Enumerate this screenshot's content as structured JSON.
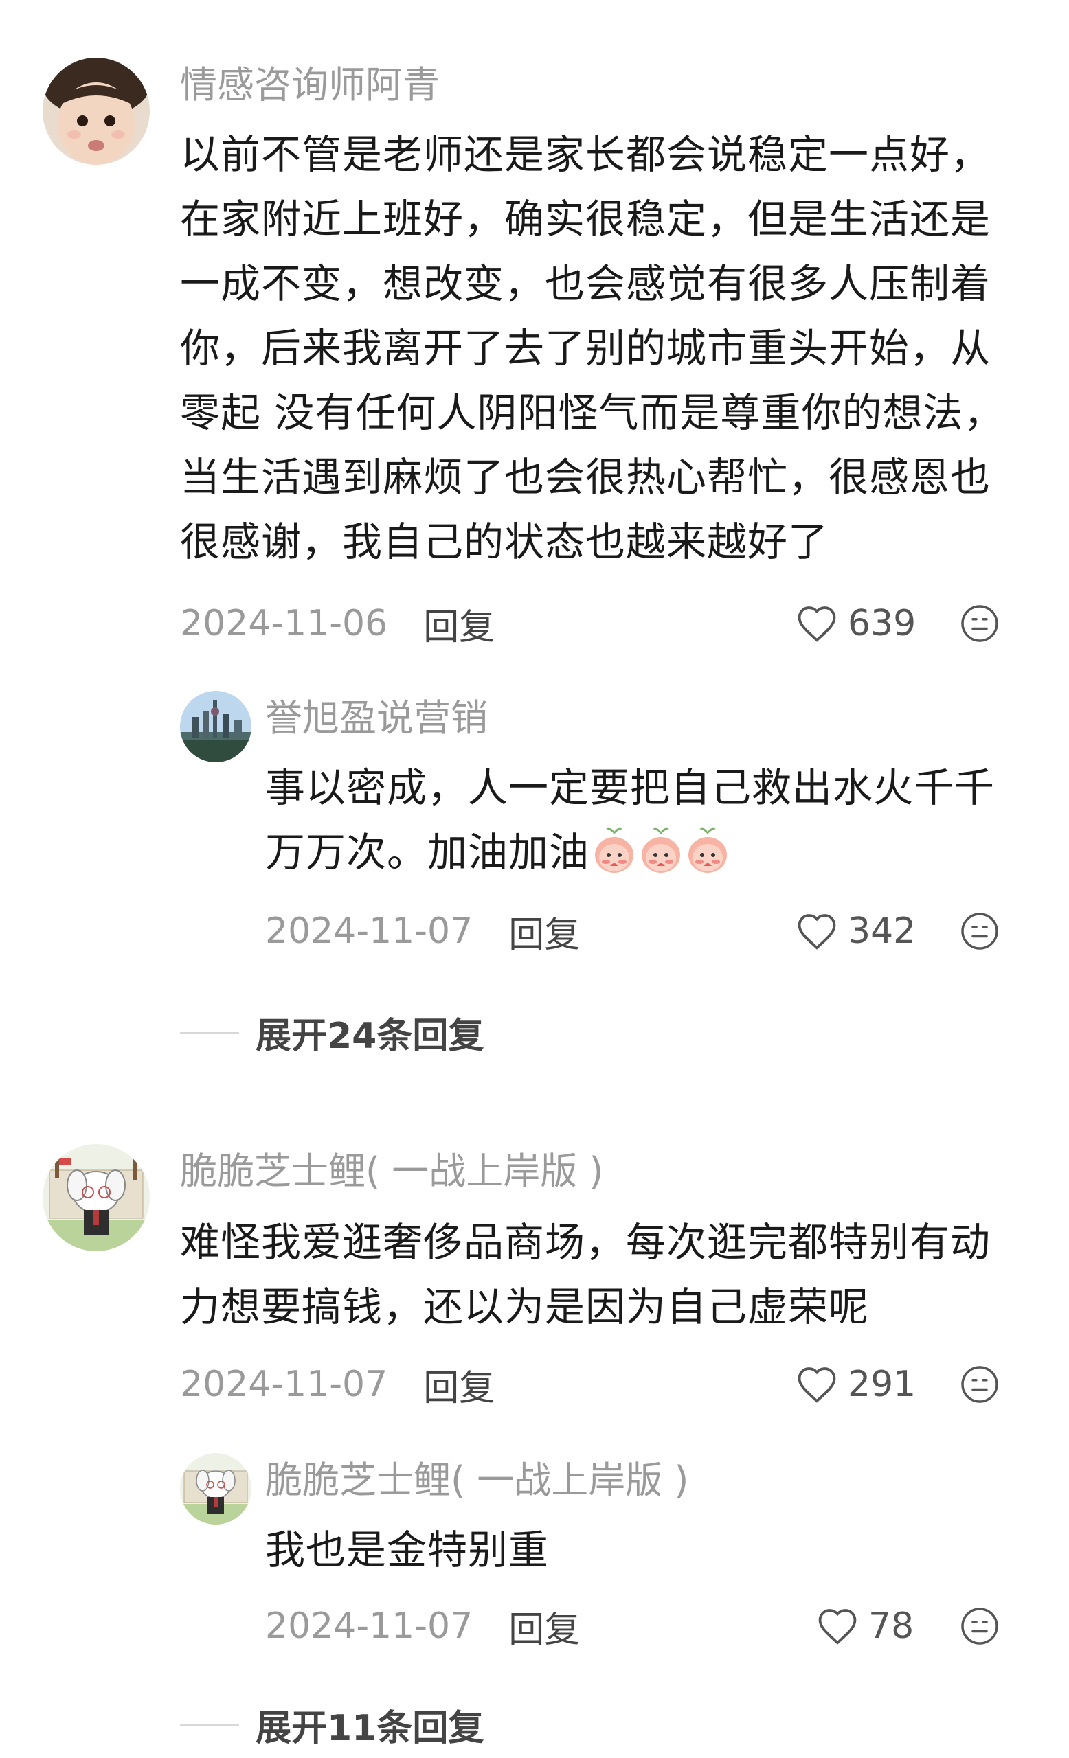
{
  "comments": [
    {
      "username": "情感咨询师阿青",
      "text_lines": [
        "以前不管是老师还是家长都会说稳定一点好，",
        "在家附近上班好，确实很稳定，但是生活还是",
        "一成不变，想改变，也会感觉有很多人压制着",
        "你，后来我离开了去了别的城市重头开始，从",
        "零起 没有任何人阴阳怪气而是尊重你的想法，",
        "当生活遇到麻烦了也会很热心帮忙，很感恩也",
        "很感谢，我自己的状态也越来越好了"
      ],
      "date": "2024-11-06",
      "reply_label": "回复",
      "likes": "639",
      "reply": {
        "username": "誉旭盈说营销",
        "text_lines": [
          "事以密成，人一定要把自己救出水火千千",
          "万万次。加油加油"
        ],
        "date": "2024-11-07",
        "reply_label": "回复",
        "likes": "342"
      },
      "expand_label": "展开24条回复"
    },
    {
      "username": "脆脆芝士鲤( 一战上岸版 )",
      "text_lines": [
        "难怪我爱逛奢侈品商场，每次逛完都特别有动",
        "力想要搞钱，还以为是因为自己虚荣呢"
      ],
      "date": "2024-11-07",
      "reply_label": "回复",
      "likes": "291",
      "reply": {
        "username": "脆脆芝士鲤( 一战上岸版 )",
        "text_lines": [
          "我也是金特别重"
        ],
        "date": "2024-11-07",
        "reply_label": "回复",
        "likes": "78"
      },
      "expand_label": "展开11条回复"
    }
  ],
  "icons": {
    "like": "heart-outline-icon",
    "emoji": "emoji-face-icon",
    "sticker": "peach-blush-sticker"
  },
  "colors": {
    "username": "#9a9a9a",
    "text": "#1a1a1a",
    "meta": "#9a9a9a",
    "reply_btn": "#444444"
  }
}
